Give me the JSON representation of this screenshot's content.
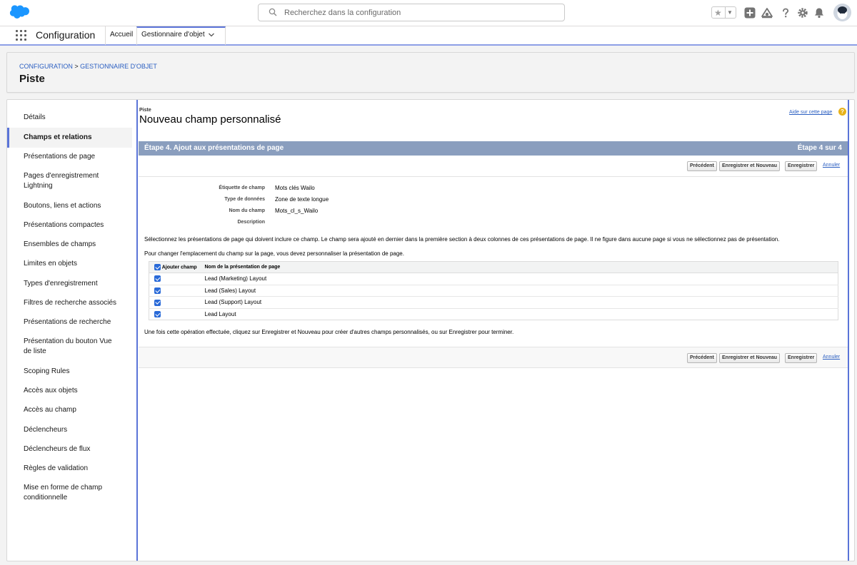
{
  "search": {
    "placeholder": "Recherchez dans la configuration"
  },
  "nav": {
    "app_name": "Configuration",
    "home": "Accueil",
    "object_manager": "Gestionnaire d'objet"
  },
  "page_header": {
    "breadcrumb_root": "CONFIGURATION",
    "breadcrumb_sep": ">",
    "breadcrumb_object": "GESTIONNAIRE D'OBJET",
    "title": "Piste"
  },
  "sidebar": {
    "items": [
      {
        "label": "Détails"
      },
      {
        "label": "Champs et relations"
      },
      {
        "label": "Présentations de page"
      },
      {
        "label": "Pages d'enregistrement Lightning"
      },
      {
        "label": "Boutons, liens et actions"
      },
      {
        "label": "Présentations compactes"
      },
      {
        "label": "Ensembles de champs"
      },
      {
        "label": "Limites en objets"
      },
      {
        "label": "Types d'enregistrement"
      },
      {
        "label": "Filtres de recherche associés"
      },
      {
        "label": "Présentations de recherche"
      },
      {
        "label": "Présentation du bouton Vue de liste"
      },
      {
        "label": "Scoping Rules"
      },
      {
        "label": "Accès aux objets"
      },
      {
        "label": "Accès au champ"
      },
      {
        "label": "Déclencheurs"
      },
      {
        "label": "Déclencheurs de flux"
      },
      {
        "label": "Règles de validation"
      },
      {
        "label": "Mise en forme de champ conditionnelle"
      }
    ],
    "active_index": 1
  },
  "content": {
    "object_label": "Piste",
    "title": "Nouveau champ personnalisé",
    "help_link": "Aide sur cette page",
    "help_icon_glyph": "?",
    "step_title": "Étape 4. Ajout aux présentations de page",
    "step_counter": "Étape 4 sur 4",
    "buttons": {
      "previous": "Précédent",
      "save_new": "Enregistrer et Nouveau",
      "save": "Enregistrer",
      "cancel": "Annuler"
    },
    "fields": [
      {
        "label": "Étiquette de champ",
        "value": "Mots clés Wailo"
      },
      {
        "label": "Type de données",
        "value": "Zone de texte longue"
      },
      {
        "label": "Nom du champ",
        "value": "Mots_cl_s_Wailo"
      },
      {
        "label": "Description",
        "value": ""
      }
    ],
    "instruction_1": "Sélectionnez les présentations de page qui doivent inclure ce champ. Le champ sera ajouté en dernier dans la première section à deux colonnes de ces présentations de page. Il ne figure dans aucune page si vous ne sélectionnez pas de présentation.",
    "instruction_2": "Pour changer l'emplacement du champ sur la page, vous devez personnaliser la présentation de page.",
    "table": {
      "col_add": "Ajouter champ",
      "col_name": "Nom de la présentation de page",
      "rows": [
        {
          "name": "Lead (Marketing) Layout",
          "checked": true
        },
        {
          "name": "Lead (Sales) Layout",
          "checked": true
        },
        {
          "name": "Lead (Support) Layout",
          "checked": true
        },
        {
          "name": "Lead Layout",
          "checked": true
        }
      ]
    },
    "footer_note": "Une fois cette opération effectuée, cliquez sur Enregistrer et Nouveau pour créer d'autres champs personnalisés, ou sur Enregistrer pour terminer."
  },
  "colors": {
    "brand_blue": "#5a74d8",
    "step_bar": "#8a9ebe",
    "link": "#2a5ec1",
    "checkbox": "#2a6ad8"
  },
  "icons": {
    "logo": "salesforce-cloud-icon",
    "search": "search-icon",
    "favorites": "star-icon",
    "add": "add-icon",
    "trailhead": "trailhead-icon",
    "help": "help-icon",
    "settings": "gear-icon",
    "notifications": "bell-icon",
    "avatar": "user-avatar",
    "app_launcher": "waffle-icon"
  }
}
